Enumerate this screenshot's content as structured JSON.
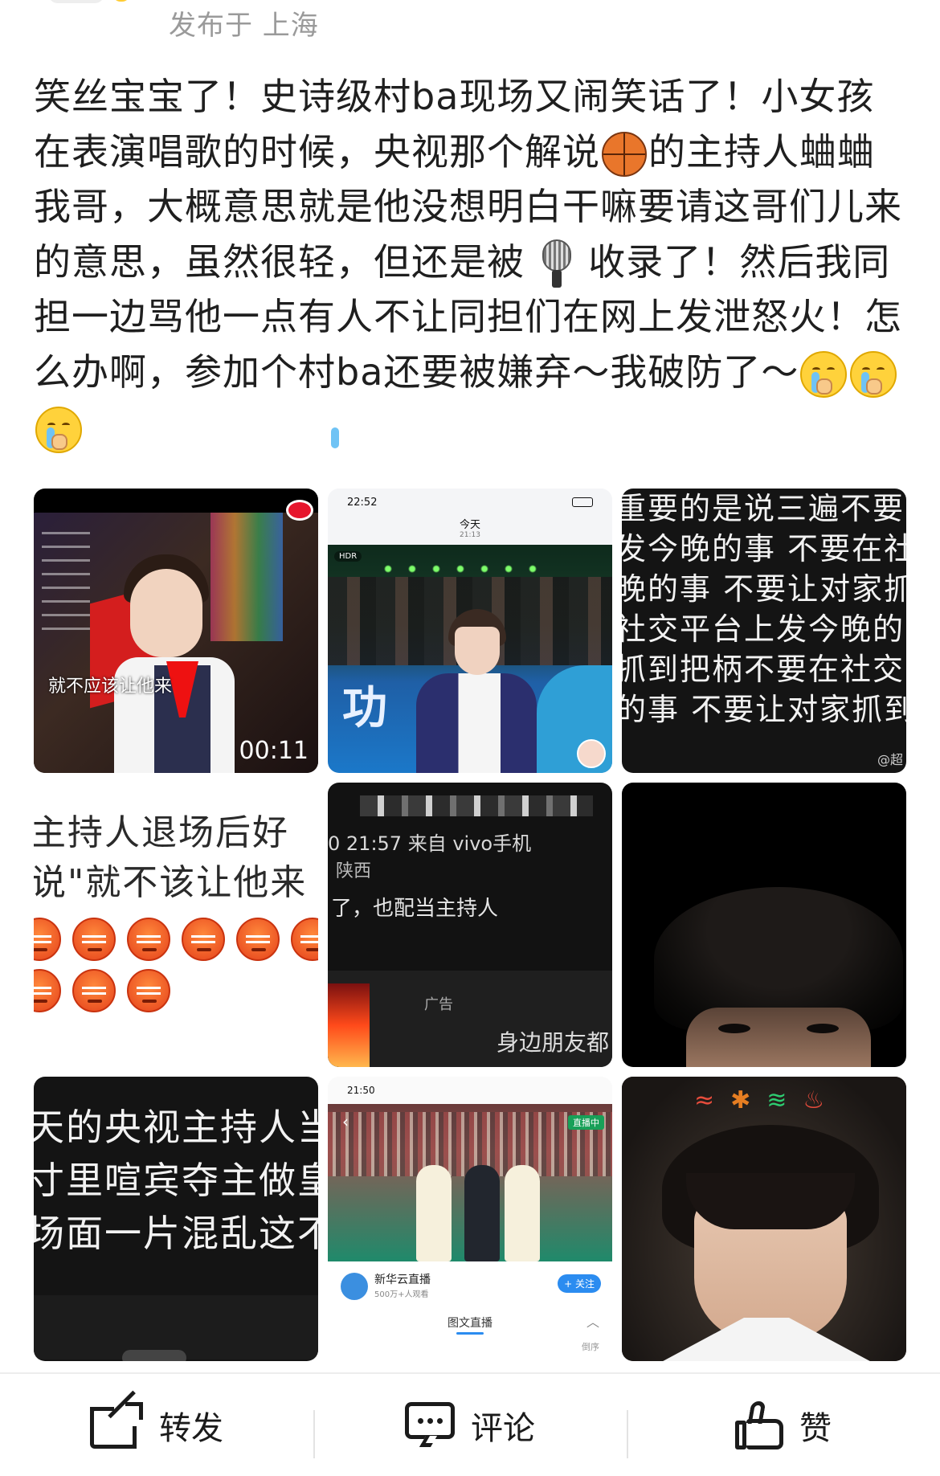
{
  "header": {
    "location": "发布于 上海"
  },
  "post": {
    "text_1": "笑丝宝宝了！史诗级村ba现场又闹笑话了！小女孩在表演唱歌的时候，央视那个解说",
    "emoji_1": "basketball-emoji",
    "text_2": "的主持人蛐蛐我哥，大概意思就是他没想明白干嘛要请这哥们儿来的意思，虽然很轻，但还是被",
    "emoji_2": "microphone-emoji",
    "text_3": "收录了！然后我同担一边骂他一点有人不让同担们在网上发泄怒火！怎么办啊，参加个村ba还要被嫌弃～我破防了～",
    "trailing_emoji": [
      "crying-emoji",
      "crying-emoji",
      "crying-emoji"
    ]
  },
  "gallery": {
    "tile1": {
      "caption": "就不应该让他来",
      "duration": "00:11"
    },
    "tile2": {
      "status_time": "22:52",
      "title": "今天",
      "subtitle": "21:13",
      "hdr": "HDR",
      "big_char": "功"
    },
    "tile3": {
      "lines": [
        "重要的是说三遍不要",
        "发今晚的事 不要在社",
        "晚的事 不要让对家抓",
        "社交平台上发今晚的",
        "抓到把柄不要在社交",
        "的事 不要让对家抓到"
      ],
      "watermark": "@超"
    },
    "tile4": {
      "lines": [
        "主持人退场后好",
        "说\"就不该让他来"
      ]
    },
    "tile5": {
      "time": "0 21:57  来自 vivo手机",
      "location": "陕西",
      "message": "了，也配当主持人",
      "ad": "广告",
      "ad_text": "身边朋友都"
    },
    "tile7": {
      "lines": [
        "天的央视主持人当",
        "寸里喧宾夺主做皇",
        "场面一片混乱这不"
      ]
    },
    "tile8": {
      "status_time": "21:50",
      "live_tag": "直播中",
      "channel_name": "新华云直播",
      "channel_sub": "500万+人观看",
      "follow": "+ 关注",
      "tab": "图文直播",
      "order": "倒序"
    }
  },
  "actions": {
    "share": "转发",
    "comment": "评论",
    "like": "赞"
  },
  "colors": {
    "accent_blue": "#2b8cf0",
    "text_dark": "#1f1f1f",
    "meta_gray": "#9a9a9a"
  }
}
